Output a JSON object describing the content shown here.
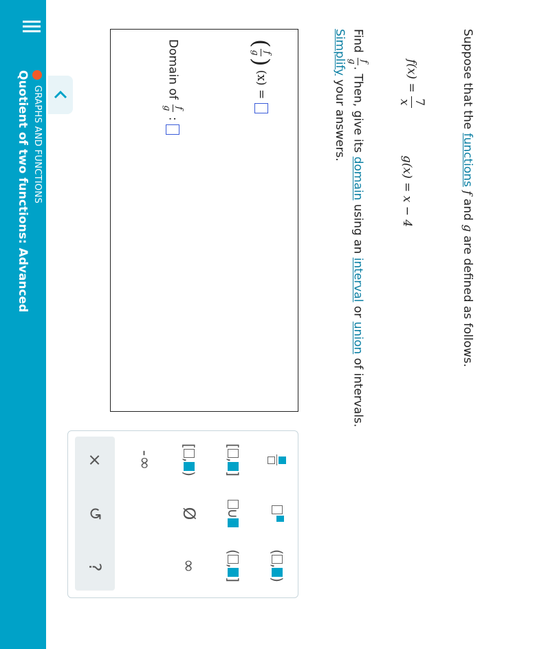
{
  "header": {
    "category": "GRAPHS AND FUNCTIONS",
    "topic": "Quotient of two functions: Advanced"
  },
  "question": {
    "intro_prefix": "Suppose that the",
    "intro_link": "functions",
    "intro_f": "f",
    "intro_and": "and",
    "intro_g": "g",
    "intro_suffix": "are defined as follows.",
    "f_def_lhs": "f(x) =",
    "f_def_num": "7",
    "f_def_den": "x",
    "g_def": "g(x) = x − 4",
    "find_prefix": "Find",
    "find_mid": ". Then, give its",
    "link_domain": "domain",
    "using": "using an",
    "link_interval": "interval",
    "or": "or",
    "link_union": "union",
    "find_suffix": "of intervals.",
    "link_simplify": "Simplify",
    "simplify_suffix": "your answers."
  },
  "answer": {
    "quotient_tail": "(x) =",
    "domain_label": "Domain of",
    "colon": ":"
  },
  "keypad": {
    "keys": [
      "fraction",
      "superscript",
      "open-interval",
      "closed-interval",
      "union",
      "half-open-right",
      "half-closed-left",
      "empty-set",
      "infinity",
      "negative-infinity"
    ],
    "neg_inf": "-∞",
    "inf": "∞",
    "empty": "Ø",
    "clear": "×",
    "undo": "↺",
    "help": "?"
  },
  "colors": {
    "header_bg": "#00a2c8",
    "accent_dot": "#f05a28",
    "link": "#0a7fa3",
    "input_box": "#3a5bd9"
  }
}
